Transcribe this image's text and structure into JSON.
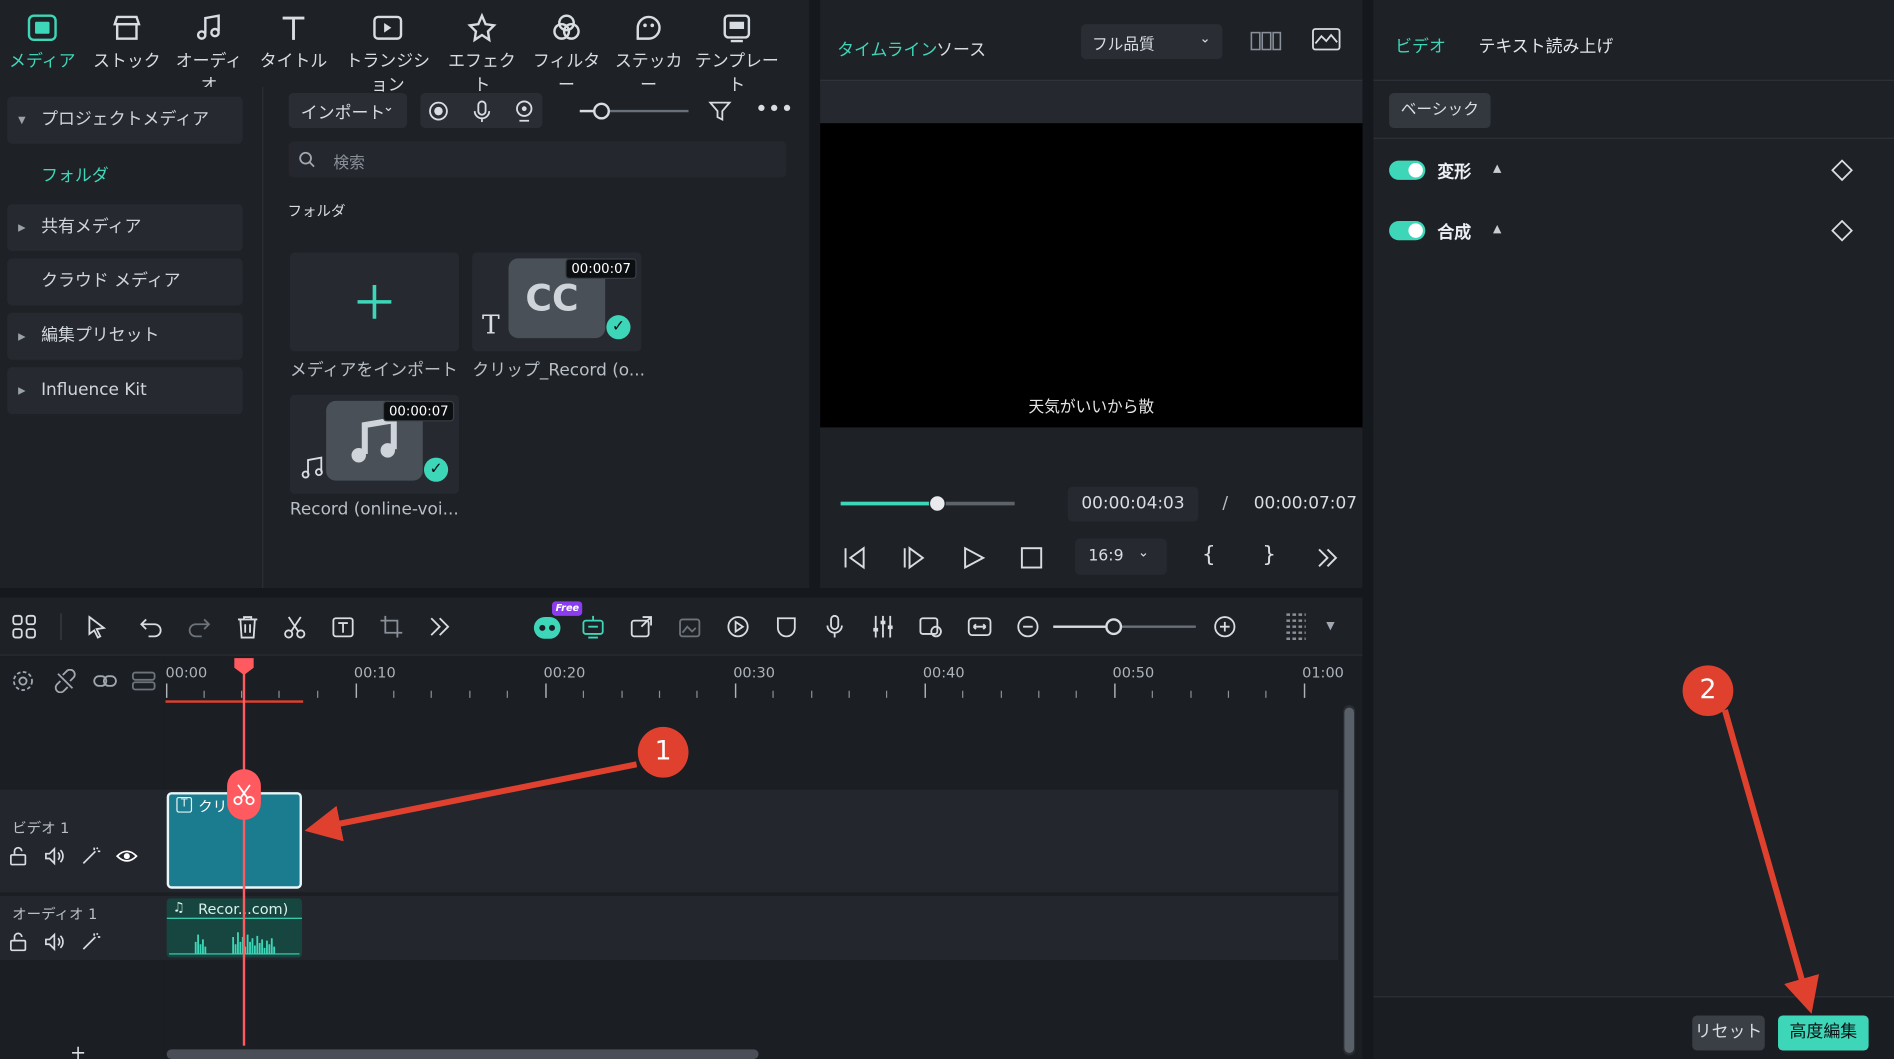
{
  "toolbar": {
    "items": [
      {
        "label": "メディア",
        "icon": "media-icon"
      },
      {
        "label": "ストック",
        "icon": "stock-icon"
      },
      {
        "label": "オーディオ",
        "icon": "audio-icon"
      },
      {
        "label": "タイトル",
        "icon": "title-icon"
      },
      {
        "label": "トランジション",
        "icon": "transition-icon"
      },
      {
        "label": "エフェクト",
        "icon": "effect-icon"
      },
      {
        "label": "フィルター",
        "icon": "filter-icon"
      },
      {
        "label": "ステッカー",
        "icon": "sticker-icon"
      },
      {
        "label": "テンプレート",
        "icon": "template-icon"
      }
    ]
  },
  "sidebar": {
    "project_media": "プロジェクトメディア",
    "folder": "フォルダ",
    "shared_media": "共有メディア",
    "cloud_media": "クラウド メディア",
    "edit_preset": "編集プリセット",
    "influence_kit": "Influence Kit"
  },
  "media": {
    "import_label": "インポート",
    "search_placeholder": "検索",
    "folder_heading": "フォルダ",
    "import_media_caption": "メディアをインポート",
    "clip1": {
      "duration": "00:00:07",
      "caption": "クリップ_Record (o...",
      "badge": "CC"
    },
    "clip2": {
      "duration": "00:00:07",
      "caption": "Record (online-voi..."
    }
  },
  "preview": {
    "tab_timeline": "タイムライン",
    "tab_source": "ソース",
    "quality": "フル品質",
    "subtitle": "天気がいいから散",
    "current_time": "00:00:04:03",
    "separator": "/",
    "total_time": "00:00:07:07",
    "aspect": "16:9",
    "progress": 0.55
  },
  "properties": {
    "tab_video": "ビデオ",
    "tab_tts": "テキスト読み上げ",
    "basic_label": "ベーシック",
    "transform_label": "変形",
    "composite_label": "合成",
    "reset_label": "リセット",
    "advanced_label": "高度編集"
  },
  "timeline": {
    "free_badge": "Free",
    "ticks": [
      "00:00",
      "00:10",
      "00:20",
      "00:30",
      "00:40",
      "00:50",
      "01:00"
    ],
    "video_track": "ビデオ 1",
    "audio_track": "オーディオ 1",
    "video_clip": "クリ   e-",
    "audio_clip": "Recor...com)",
    "add_track": "+"
  },
  "annotations": {
    "marker1": "1",
    "marker2": "2"
  },
  "colors": {
    "accent": "#3ed6b8",
    "marker": "#e0412f",
    "playhead": "#ff5a5f",
    "clip": "#1a7c8e"
  }
}
